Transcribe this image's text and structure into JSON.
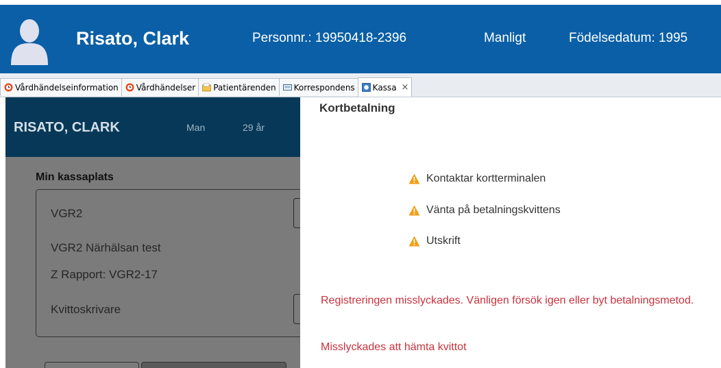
{
  "header": {
    "patient_name": "Risato, Clark",
    "personnr": "Personnr.: 19950418-2396",
    "gender": "Manligt",
    "birthdate": "Födelsedatum: 1995"
  },
  "tabs": [
    {
      "label": "Vårdhändelseinformation",
      "icon": "clock-icon"
    },
    {
      "label": "Vårdhändelser",
      "icon": "clock-icon"
    },
    {
      "label": "Patientärenden",
      "icon": "folder-icon"
    },
    {
      "label": "Korrespondens",
      "icon": "envelope-icon"
    },
    {
      "label": "Kassa",
      "icon": "register-icon",
      "active": true,
      "close": "×"
    }
  ],
  "left_panel": {
    "patient_name": "RISATO, CLARK",
    "gender": "Man",
    "age": "29 år",
    "section_label": "Min kassaplats",
    "register": "VGR2",
    "unit": "VGR2 Närhälsan test",
    "z_report": "Z Rapport: VGR2-17",
    "printer": "Kvittoskrivare"
  },
  "payment": {
    "title": "Kortbetalning",
    "steps": [
      {
        "label": "Kontaktar kortterminalen",
        "icon": "warning-icon"
      },
      {
        "label": "Vänta på betalningskvittens",
        "icon": "warning-icon"
      },
      {
        "label": "Utskrift",
        "icon": "warning-icon"
      }
    ],
    "error_registration": "Registreringen misslyckades. Vänligen försök igen eller byt betalningsmetod.",
    "error_receipt": "Misslyckades att hämta kvittot",
    "warning_color": "#f0a019",
    "error_color": "#c8323d"
  },
  "colors": {
    "header_bg": "#0a5fa6",
    "left_bar_bg": "#073857"
  }
}
